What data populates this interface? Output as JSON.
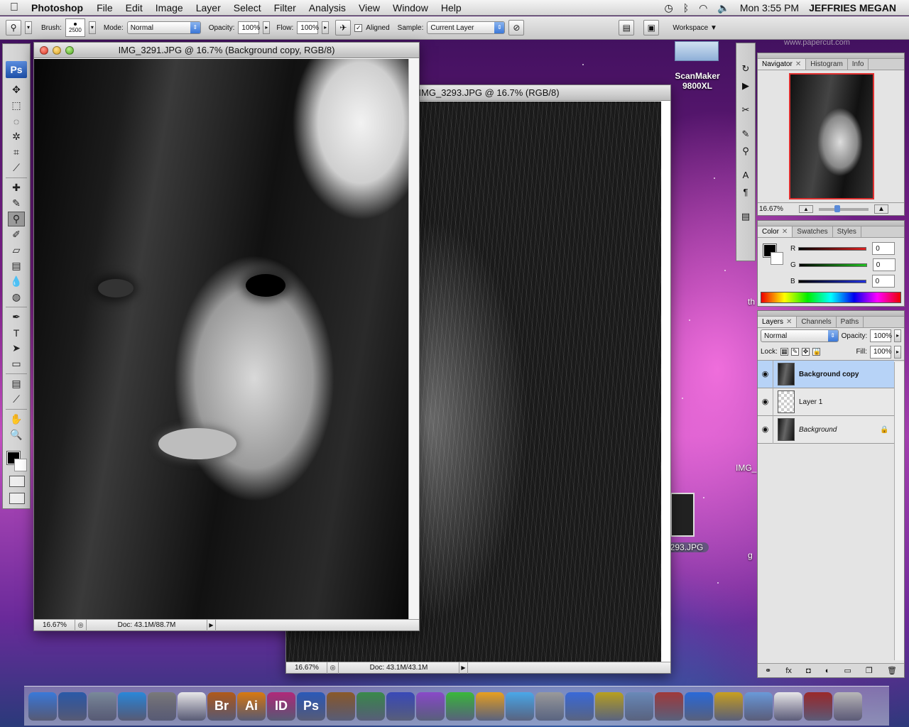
{
  "menubar": {
    "app_name": "Photoshop",
    "menus": [
      "File",
      "Edit",
      "Image",
      "Layer",
      "Select",
      "Filter",
      "Analysis",
      "View",
      "Window",
      "Help"
    ],
    "clock": "Mon 3:55 PM",
    "user": "JEFFRIES MEGAN"
  },
  "options": {
    "brush_label": "Brush:",
    "brush_size": "2500",
    "mode_label": "Mode:",
    "mode_value": "Normal",
    "opacity_label": "Opacity:",
    "opacity_value": "100%",
    "flow_label": "Flow:",
    "flow_value": "100%",
    "aligned_label": "Aligned",
    "sample_label": "Sample:",
    "sample_value": "Current Layer",
    "workspace_label": "Workspace"
  },
  "tools": {
    "logo": "Ps",
    "items": [
      {
        "name": "move-tool",
        "glyph": "✥"
      },
      {
        "name": "marquee-tool",
        "glyph": "⬚"
      },
      {
        "name": "lasso-tool",
        "glyph": "◌"
      },
      {
        "name": "magic-wand-tool",
        "glyph": "✲"
      },
      {
        "name": "crop-tool",
        "glyph": "⌗"
      },
      {
        "name": "eyedropper-slice-tool",
        "glyph": "⟋"
      },
      {
        "name": "healing-brush-tool",
        "glyph": "✚"
      },
      {
        "name": "brush-tool",
        "glyph": "✎"
      },
      {
        "name": "clone-stamp-tool",
        "glyph": "⚲",
        "active": true
      },
      {
        "name": "history-brush-tool",
        "glyph": "✐"
      },
      {
        "name": "eraser-tool",
        "glyph": "▱"
      },
      {
        "name": "gradient-tool",
        "glyph": "▤"
      },
      {
        "name": "blur-tool",
        "glyph": "💧"
      },
      {
        "name": "dodge-tool",
        "glyph": "◍"
      },
      {
        "name": "pen-tool",
        "glyph": "✒"
      },
      {
        "name": "type-tool",
        "glyph": "T"
      },
      {
        "name": "path-selection-tool",
        "glyph": "➤"
      },
      {
        "name": "shape-tool",
        "glyph": "▭"
      },
      {
        "name": "notes-tool",
        "glyph": "▤"
      },
      {
        "name": "eyedropper-tool",
        "glyph": "⟋"
      },
      {
        "name": "hand-tool",
        "glyph": "✋"
      },
      {
        "name": "zoom-tool",
        "glyph": "🔍"
      }
    ]
  },
  "doc1": {
    "title": "IMG_3291.JPG @ 16.7% (Background copy, RGB/8)",
    "zoom": "16.67%",
    "doc_size": "Doc: 43.1M/88.7M"
  },
  "doc2": {
    "title": "IMG_3293.JPG @ 16.7% (RGB/8)",
    "zoom": "16.67%",
    "doc_size": "Doc: 43.1M/43.1M"
  },
  "navigator": {
    "tabs": [
      "Navigator",
      "Histogram",
      "Info"
    ],
    "zoom": "16.67%",
    "slider_fraction": 0.35
  },
  "color": {
    "tabs": [
      "Color",
      "Swatches",
      "Styles"
    ],
    "channels": [
      {
        "label": "R",
        "value": "0",
        "color": "#e02020"
      },
      {
        "label": "G",
        "value": "0",
        "color": "#20c020"
      },
      {
        "label": "B",
        "value": "0",
        "color": "#2030e0"
      }
    ]
  },
  "layers": {
    "tabs": [
      "Layers",
      "Channels",
      "Paths"
    ],
    "blend_mode": "Normal",
    "opacity_label": "Opacity:",
    "opacity_value": "100%",
    "lock_label": "Lock:",
    "fill_label": "Fill:",
    "fill_value": "100%",
    "items": [
      {
        "name": "Background copy",
        "selected": true
      },
      {
        "name": "Layer 1",
        "selected": false
      },
      {
        "name": "Background",
        "selected": false,
        "locked": true
      }
    ]
  },
  "desktop": {
    "scanner_label": "ScanMaker\n9800XL",
    "scanner_line1": "ScanMaker",
    "scanner_line2": "9800XL",
    "file_label": "293.JPG",
    "partial_label1": "IMG_",
    "partial_label2": "th",
    "partial_label3": "g",
    "watermark": "www.papercut.com"
  },
  "dock": {
    "items": [
      {
        "name": "finder-icon",
        "label": "",
        "color": "#3a7ad8"
      },
      {
        "name": "dashboard-icon",
        "label": "",
        "color": "#2a5aa8"
      },
      {
        "name": "directory-icon",
        "label": "",
        "color": "#7a8a9a"
      },
      {
        "name": "safari-icon",
        "label": "",
        "color": "#2a88d8"
      },
      {
        "name": "system-prefs-icon",
        "label": "",
        "color": "#7a7a7a"
      },
      {
        "name": "acrobat-icon",
        "label": "",
        "color": "#e8e8e8"
      },
      {
        "name": "bridge-icon",
        "label": "Br",
        "color": "#b05a1a"
      },
      {
        "name": "illustrator-icon",
        "label": "Ai",
        "color": "#d87a10"
      },
      {
        "name": "indesign-icon",
        "label": "ID",
        "color": "#b02a7a"
      },
      {
        "name": "photoshop-icon",
        "label": "Ps",
        "color": "#2a5ab8"
      },
      {
        "name": "keynote-icon",
        "label": "",
        "color": "#8a5a2a"
      },
      {
        "name": "numbers-icon",
        "label": "",
        "color": "#3a8a4a"
      },
      {
        "name": "pen-app-icon",
        "label": "",
        "color": "#3a4ab8"
      },
      {
        "name": "e-app-icon",
        "label": "",
        "color": "#8a4ac8"
      },
      {
        "name": "green-app-icon",
        "label": "",
        "color": "#3ab83a"
      },
      {
        "name": "p-app-icon",
        "label": "",
        "color": "#e8a020"
      },
      {
        "name": "w-app-icon",
        "label": "",
        "color": "#4aa8e8"
      },
      {
        "name": "camera-icon",
        "label": "",
        "color": "#9a9a9a"
      },
      {
        "name": "dvd-icon",
        "label": "",
        "color": "#3a6ad8"
      },
      {
        "name": "imovie-icon",
        "label": "",
        "color": "#b8a020"
      },
      {
        "name": "iphoto-icon",
        "label": "",
        "color": "#6a8ab8"
      },
      {
        "name": "photo-booth-icon",
        "label": "",
        "color": "#a03a3a"
      },
      {
        "name": "quicktime-icon",
        "label": "",
        "color": "#2a6ad8"
      },
      {
        "name": "keychain-icon",
        "label": "",
        "color": "#c8a020"
      },
      {
        "name": "folder-icon",
        "label": "",
        "color": "#6a9ad8"
      },
      {
        "name": "docx-icon",
        "label": "",
        "color": "#e8e8e8"
      },
      {
        "name": "remote-icon",
        "label": "",
        "color": "#9a2a2a"
      },
      {
        "name": "trash-icon",
        "label": "",
        "color": "#b8b8b8"
      }
    ]
  }
}
